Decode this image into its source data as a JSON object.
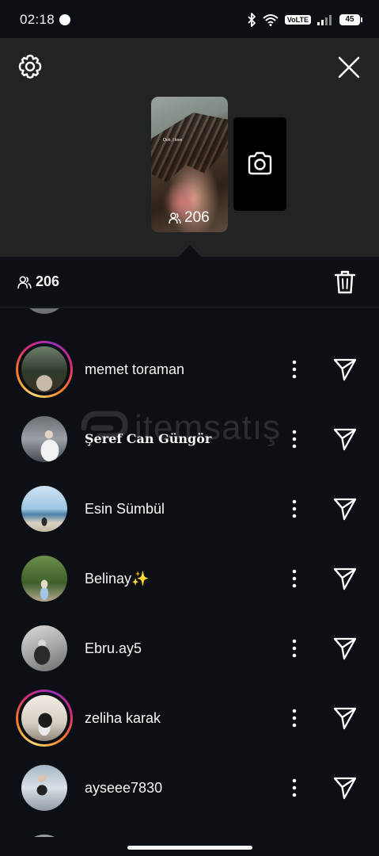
{
  "status_bar": {
    "time": "02:18",
    "volte": "VoLTE",
    "battery": "45",
    "icons": [
      "chat-bubble-icon",
      "bluetooth-icon",
      "wifi-icon",
      "signal-icon",
      "battery-icon"
    ]
  },
  "top_panel": {
    "settings_icon": "gear-icon",
    "close_icon": "close-icon",
    "story": {
      "caption": "Ooh, I love",
      "viewer_count": "206",
      "viewer_icon": "people-icon"
    },
    "camera_icon": "camera-icon"
  },
  "viewers_header": {
    "count": "206",
    "icon": "people-icon",
    "delete_icon": "trash-icon"
  },
  "viewers": [
    {
      "username": "memet toraman",
      "ring": true
    },
    {
      "username": "Şeref Can Güngör",
      "ring": false,
      "style": "serif-bold"
    },
    {
      "username": "Esin Sümbül",
      "ring": false
    },
    {
      "username": "Belinay✨",
      "ring": false
    },
    {
      "username": "Ebru.ay5",
      "ring": false
    },
    {
      "username": "zeliha karak",
      "ring": true
    },
    {
      "username": "ayseee7830",
      "ring": false
    }
  ],
  "row_actions": {
    "more_icon": "more-vertical-icon",
    "send_icon": "send-icon"
  },
  "watermark": {
    "text": "itemsatış"
  },
  "colors": {
    "background": "#0c1014",
    "panel": "#212325",
    "text": "#f5f5f5",
    "ring_gradient": [
      "#feda75",
      "#fa7e1e",
      "#d62976",
      "#962fbf"
    ]
  }
}
